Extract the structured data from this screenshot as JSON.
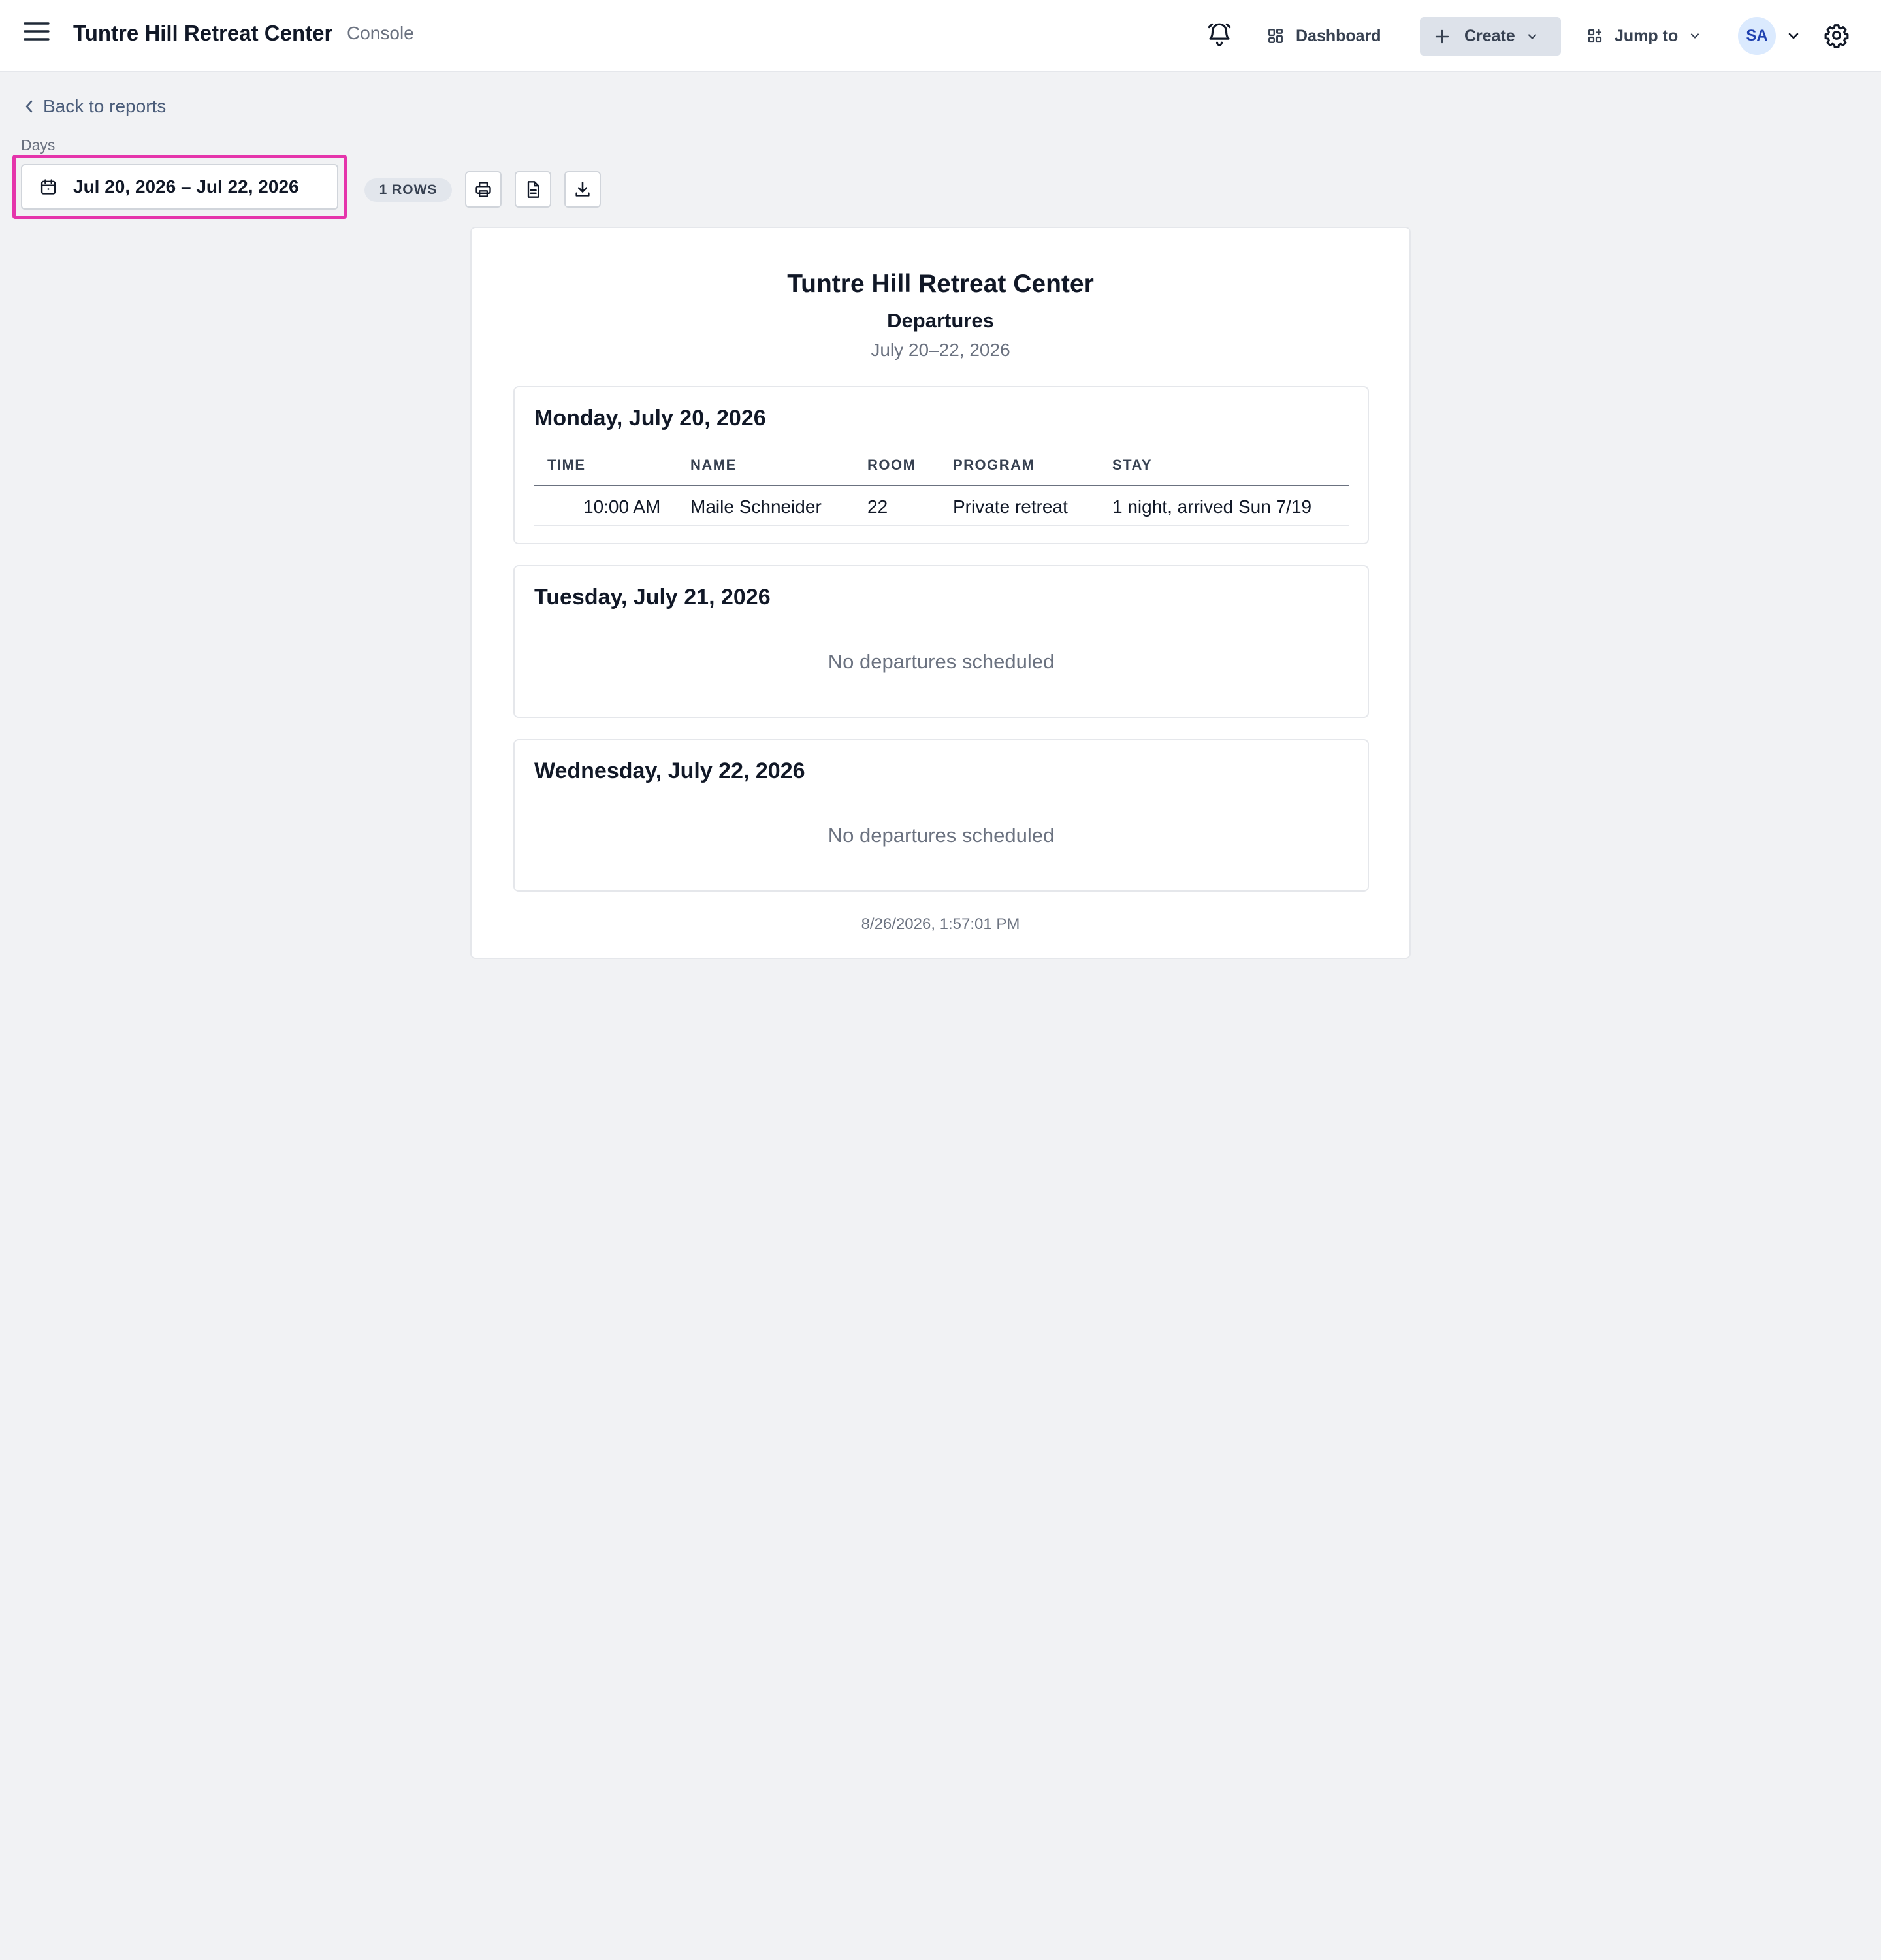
{
  "header": {
    "app_title": "Tuntre Hill Retreat Center",
    "app_subtitle": "Console",
    "dashboard_label": "Dashboard",
    "create_label": "Create",
    "jump_label": "Jump to",
    "avatar_initials": "SA"
  },
  "toolbar": {
    "back_label": "Back to reports",
    "days_label": "Days",
    "date_range": "Jul 20, 2026 – Jul 22, 2026",
    "rows_badge": "1 ROWS"
  },
  "report": {
    "title": "Tuntre Hill Retreat Center",
    "subtitle": "Departures",
    "date_range": "July 20–22, 2026",
    "columns": [
      "TIME",
      "NAME",
      "ROOM",
      "PROGRAM",
      "STAY"
    ],
    "days": [
      {
        "title": "Monday, July 20, 2026",
        "rows": [
          {
            "time": "10:00 AM",
            "name": "Maile Schneider",
            "room": "22",
            "program": "Private retreat",
            "stay": "1 night, arrived Sun 7/19"
          }
        ]
      },
      {
        "title": "Tuesday, July 21, 2026",
        "empty_text": "No departures scheduled"
      },
      {
        "title": "Wednesday, July 22, 2026",
        "empty_text": "No departures scheduled"
      }
    ],
    "generated_at": "8/26/2026, 1:57:01 PM"
  },
  "colors": {
    "background": "#f1f2f4",
    "highlight": "#e535ab",
    "create_button_bg": "#dde2ea",
    "avatar_bg": "#dbeafe"
  },
  "icons": [
    "menu-icon",
    "bell-icon",
    "dashboard-icon",
    "plus-icon",
    "chevron-down-icon",
    "jump-icon",
    "gear-icon",
    "chevron-left-icon",
    "calendar-icon",
    "print-icon",
    "document-icon",
    "download-icon"
  ]
}
